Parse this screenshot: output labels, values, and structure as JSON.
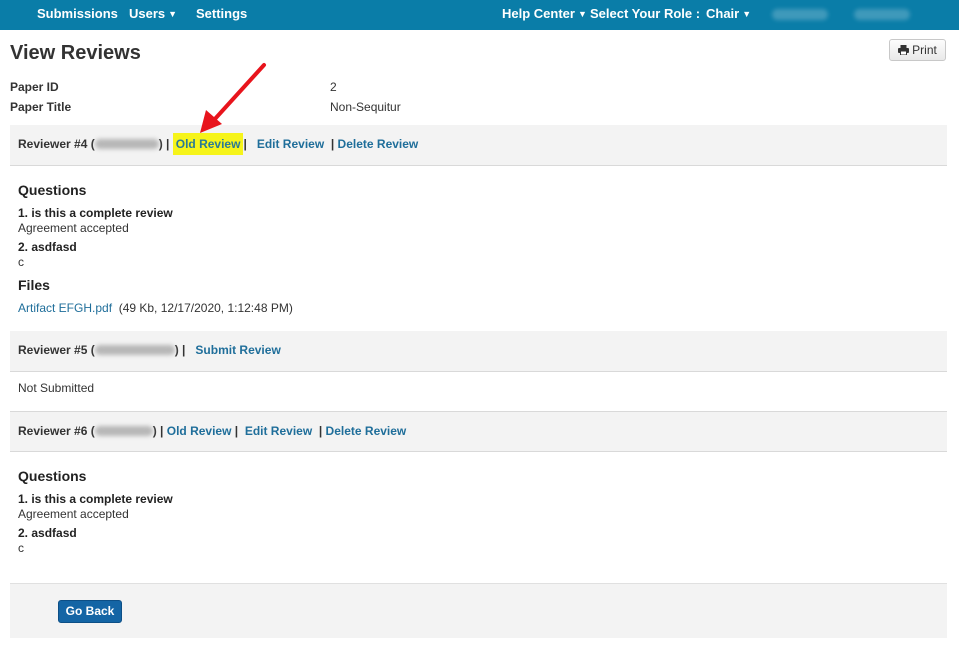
{
  "nav": {
    "submissions": "Submissions",
    "users": "Users",
    "settings": "Settings",
    "help_center": "Help Center",
    "select_role": "Select Your Role :",
    "role": "Chair"
  },
  "page": {
    "title": "View Reviews",
    "print_label": "Print"
  },
  "paper": {
    "id_label": "Paper ID",
    "id_value": "2",
    "title_label": "Paper Title",
    "title_value": "Non-Sequitur"
  },
  "reviews": [
    {
      "label": "Reviewer #4 (",
      "links": {
        "old": "Old Review",
        "edit": "Edit Review",
        "delete": "Delete Review"
      },
      "questions_heading": "Questions",
      "questions": [
        {
          "q": "1. is this a complete review",
          "a": "Agreement accepted"
        },
        {
          "q": "2. asdfasd",
          "a": "c"
        }
      ],
      "files_heading": "Files",
      "file": {
        "name": "Artifact EFGH.pdf",
        "info": "(49 Kb, 12/17/2020, 1:12:48 PM)"
      }
    },
    {
      "label": "Reviewer #5 (",
      "links": {
        "submit": "Submit Review"
      },
      "status": "Not Submitted"
    },
    {
      "label": "Reviewer #6 (",
      "links": {
        "old": "Old Review",
        "edit": "Edit Review",
        "delete": "Delete Review"
      },
      "questions_heading": "Questions",
      "questions": [
        {
          "q": "1. is this a complete review",
          "a": "Agreement accepted"
        },
        {
          "q": "2. asdfasd",
          "a": "c"
        }
      ]
    }
  ],
  "symbols": {
    "close_paren_sep": ") |",
    "sep": "|"
  },
  "footer": {
    "go_back": "Go Back"
  },
  "colors": {
    "nav_bg": "#0a7da8",
    "link": "#1f6e9a",
    "highlight": "#f6f41a",
    "arrow": "#e8141c",
    "primary_button": "#1465a5"
  },
  "icons": {
    "print": "printer-icon",
    "dropdown": "caret-down-icon",
    "annotation": "red-arrow-icon"
  }
}
